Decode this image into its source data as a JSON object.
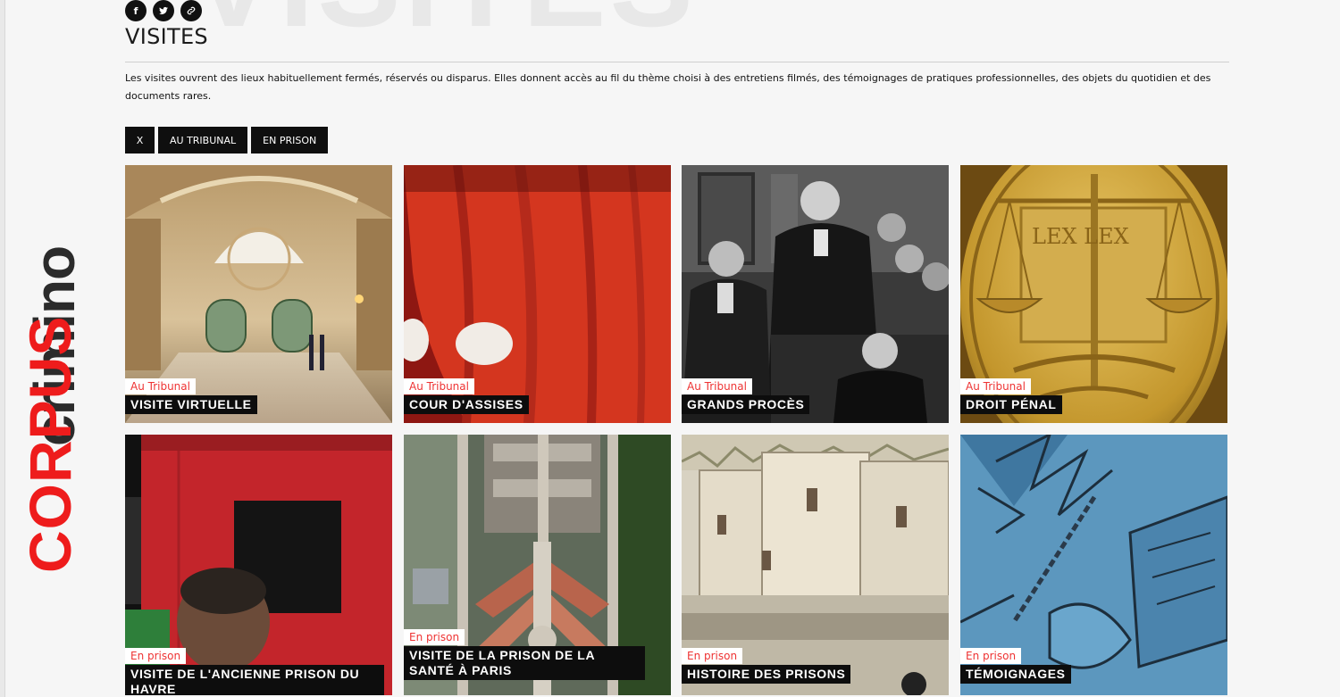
{
  "brand": {
    "line1": "crimino",
    "line2": "CORPUS",
    "accent": "#ee1c1c"
  },
  "header": {
    "ghost_title": "VISITES",
    "title": "VISITES",
    "social": [
      {
        "icon": "facebook-icon",
        "glyph": "f"
      },
      {
        "icon": "twitter-icon",
        "glyph": "t"
      },
      {
        "icon": "link-icon",
        "glyph": "🔗"
      }
    ]
  },
  "intro": "Les visites ouvrent des lieux habituellement fermés, réservés ou disparus. Elles donnent accès au fil du thème choisi à des entretiens filmés, des témoignages de pratiques professionnelles, des objets du quotidien et des documents rares.",
  "filters": [
    "X",
    "AU TRIBUNAL",
    "EN PRISON"
  ],
  "cards": [
    {
      "category": "Au Tribunal",
      "title": "VISITE VIRTUELLE"
    },
    {
      "category": "Au Tribunal",
      "title": "COUR D'ASSISES"
    },
    {
      "category": "Au Tribunal",
      "title": "GRANDS PROCÈS"
    },
    {
      "category": "Au Tribunal",
      "title": "DROIT PÉNAL"
    },
    {
      "category": "En prison",
      "title": "VISITE DE L'ANCIENNE PRISON DU HAVRE"
    },
    {
      "category": "En prison",
      "title": "VISITE DE LA PRISON DE LA SANTÉ À PARIS"
    },
    {
      "category": "En prison",
      "title": "HISTOIRE DES PRISONS"
    },
    {
      "category": "En prison",
      "title": "TÉMOIGNAGES"
    }
  ],
  "lex_text": "LEX LEX"
}
